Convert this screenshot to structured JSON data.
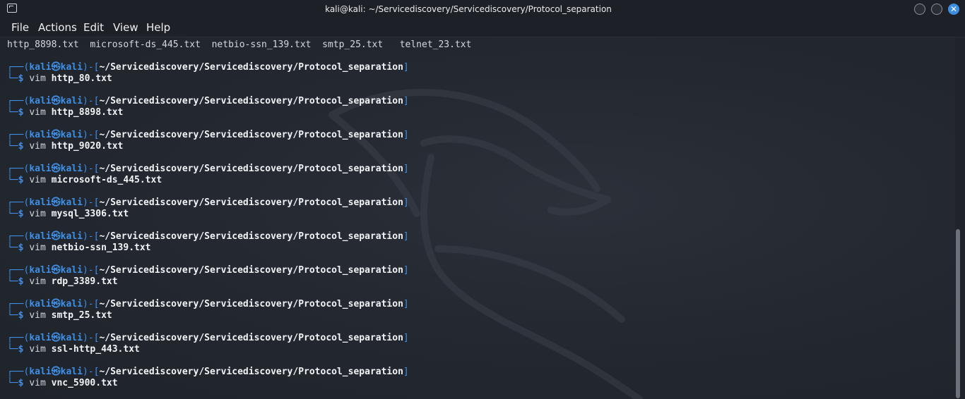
{
  "window": {
    "title": "kali@kali: ~/Servicediscovery/Servicediscovery/Protocol_separation",
    "close_glyph": "✕"
  },
  "menu": [
    "File",
    "Actions",
    "Edit",
    "View",
    "Help"
  ],
  "terminal": {
    "ls_output": "http_8898.txt  microsoft-ds_445.txt  netbio-ssn_139.txt  smtp_25.txt   telnet_23.txt",
    "prompt": {
      "corner_top": "┌──(",
      "user": "kali",
      "at": "㉿",
      "host": "kali",
      "mid": ")-[",
      "path": "~/Servicediscovery/Servicediscovery/Protocol_separation",
      "close": "]",
      "corner_bottom": "└─",
      "dollar": "$"
    },
    "commands": [
      {
        "cmd": "vim",
        "arg": "http_80.txt"
      },
      {
        "cmd": "vim",
        "arg": "http_8898.txt"
      },
      {
        "cmd": "vim",
        "arg": "http_9020.txt"
      },
      {
        "cmd": "vim",
        "arg": "microsoft-ds_445.txt"
      },
      {
        "cmd": "vim",
        "arg": "mysql_3306.txt"
      },
      {
        "cmd": "vim",
        "arg": "netbio-ssn_139.txt"
      },
      {
        "cmd": "vim",
        "arg": "rdp_3389.txt"
      },
      {
        "cmd": "vim",
        "arg": "smtp_25.txt"
      },
      {
        "cmd": "vim",
        "arg": "ssl-http_443.txt"
      },
      {
        "cmd": "vim",
        "arg": "vnc_5900.txt"
      }
    ]
  },
  "colors": {
    "prompt_blue": "#3f8fe6",
    "background": "#232730",
    "close_button": "#3d8de0"
  }
}
